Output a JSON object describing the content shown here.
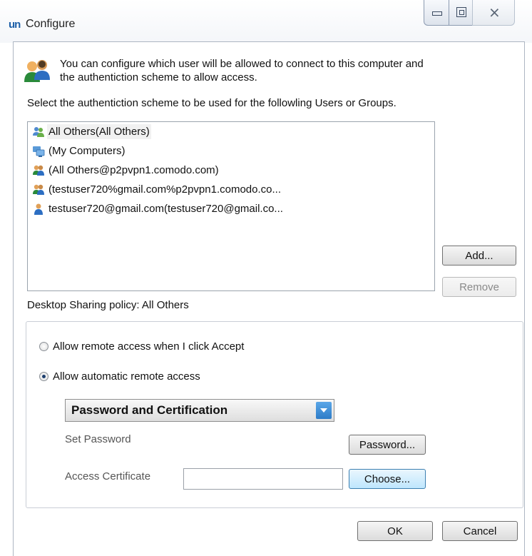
{
  "window": {
    "title": "Configure",
    "logo": "un"
  },
  "intro": {
    "line1": "You can configure which user will be allowed to connect to this computer and",
    "line2": "the authentiction  scheme  to allow access.",
    "icon": "users-icon"
  },
  "select_label": "Select the authentiction scheme to be used for the followling Users or Groups.",
  "users": [
    {
      "label": "All Others(All Others)",
      "icon": "group-icon",
      "selected": true
    },
    {
      "label": "(My Computers)",
      "icon": "computers-icon",
      "selected": false
    },
    {
      "label": "(All Others@p2pvpn1.comodo.com)",
      "icon": "group-icon",
      "selected": false
    },
    {
      "label": "(testuser720%gmail.com%p2pvpn1.comodo.co...",
      "icon": "group-icon",
      "selected": false
    },
    {
      "label": "testuser720@gmail.com(testuser720@gmail.co...",
      "icon": "user-icon",
      "selected": false
    }
  ],
  "buttons": {
    "add": "Add...",
    "remove": "Remove",
    "password": "Password...",
    "choose": "Choose...",
    "ok": "OK",
    "cancel": "Cancel"
  },
  "policy": {
    "label": "Desktop Sharing policy: All Others",
    "option_accept": "Allow remote access when I click Accept",
    "option_auto": "Allow automatic remote access",
    "selected_option": "auto",
    "scheme": "Password and Certification",
    "set_password_label": "Set Password",
    "access_cert_label": "Access Certificate",
    "access_cert_value": ""
  },
  "colors": {
    "accent": "#2d7cc8",
    "title_logo": "#1d5fa8"
  }
}
